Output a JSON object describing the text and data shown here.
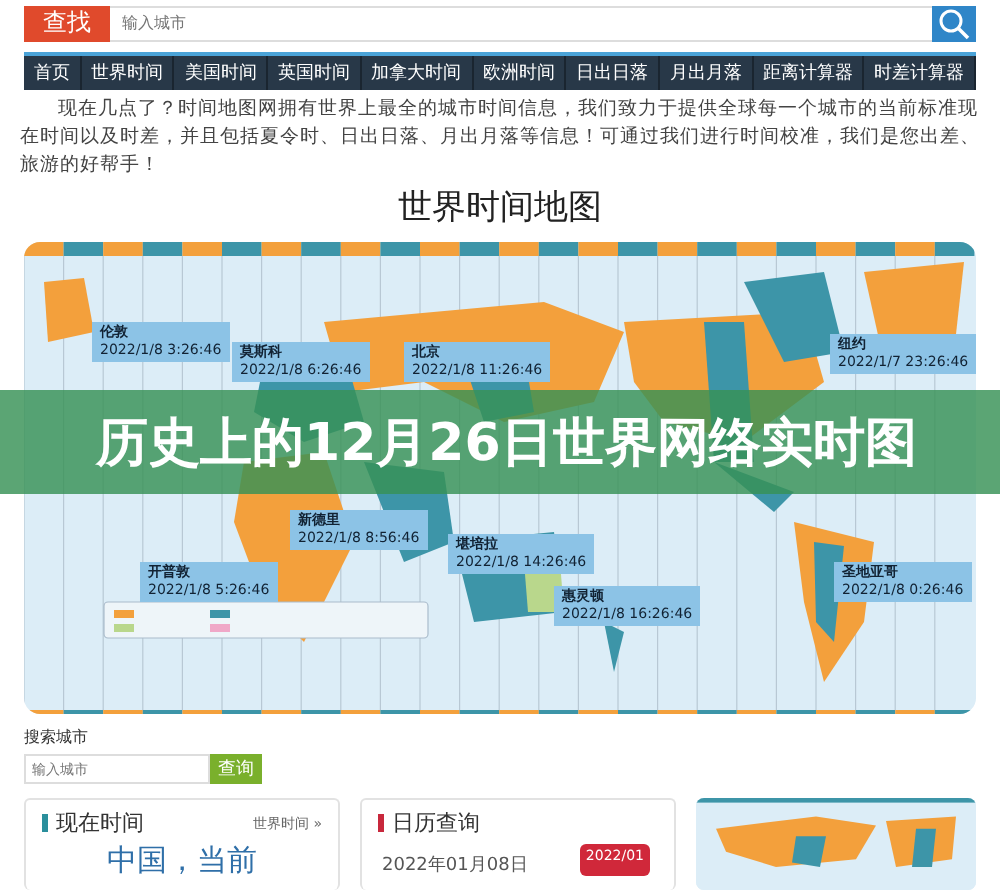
{
  "search_bar": {
    "button": "查找",
    "placeholder": "输入城市"
  },
  "nav": [
    {
      "label": "首页",
      "selected": false
    },
    {
      "label": "世界时间",
      "selected": false
    },
    {
      "label": "美国时间",
      "selected": false
    },
    {
      "label": "英国时间",
      "selected": false
    },
    {
      "label": "加拿大时间",
      "selected": false
    },
    {
      "label": "欧洲时间",
      "selected": false
    },
    {
      "label": "日出日落",
      "selected": false
    },
    {
      "label": "月出月落",
      "selected": false
    },
    {
      "label": "距离计算器",
      "selected": false
    },
    {
      "label": "时差计算器",
      "selected": false
    }
  ],
  "intro": "现在几点了？时间地图网拥有世界上最全的城市时间信息，我们致力于提供全球每一个城市的当前标准现在时间以及时差，并且包括夏令时、日出日落、月出月落等信息！可通过我们进行时间校准，我们是您出差、旅游的好帮手！",
  "map_section": {
    "title": "世界时间地图",
    "callouts": [
      {
        "city": "伦敦",
        "time": "2022/1/8 3:26:46"
      },
      {
        "city": "莫斯科",
        "time": "2022/1/8 6:26:46"
      },
      {
        "city": "北京",
        "time": "2022/1/8 11:26:46"
      },
      {
        "city": "纽约",
        "time": "2022/1/7 23:26:46"
      },
      {
        "city": "新德里",
        "time": "2022/1/8 8:56:46"
      },
      {
        "city": "开普敦",
        "time": "2022/1/8 5:26:46"
      },
      {
        "city": "堪培拉",
        "time": "2022/1/8 14:26:46"
      },
      {
        "city": "惠灵顿",
        "time": "2022/1/8 16:26:46"
      },
      {
        "city": "圣地亚哥",
        "time": "2022/1/8 0:26:46"
      }
    ]
  },
  "banner": "历史上的12月26日世界网络实时图",
  "city_search": {
    "label": "搜索城市",
    "placeholder": "输入城市",
    "button": "查询"
  },
  "cards": [
    {
      "kind": "now",
      "title": "现在时间",
      "color": "#2a8f9c",
      "link": "世界时间 »",
      "headline": "中国，当前"
    },
    {
      "kind": "calendar",
      "title": "日历查询",
      "color": "#c8283c",
      "date": "2022年01月08日",
      "icon_text": "2022/01"
    },
    {
      "kind": "map"
    }
  ]
}
